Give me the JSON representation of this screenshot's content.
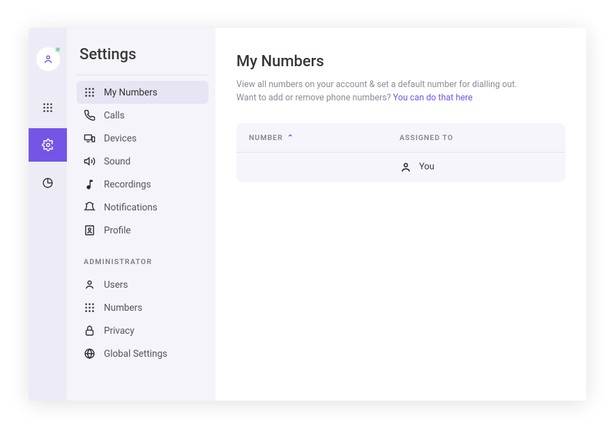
{
  "sidebar": {
    "title": "Settings",
    "items": [
      {
        "label": "My Numbers"
      },
      {
        "label": "Calls"
      },
      {
        "label": "Devices"
      },
      {
        "label": "Sound"
      },
      {
        "label": "Recordings"
      },
      {
        "label": "Notifications"
      },
      {
        "label": "Profile"
      }
    ],
    "adminLabel": "ADMINISTRATOR",
    "adminItems": [
      {
        "label": "Users"
      },
      {
        "label": "Numbers"
      },
      {
        "label": "Privacy"
      },
      {
        "label": "Global Settings"
      }
    ]
  },
  "main": {
    "title": "My Numbers",
    "descLine1": "View all numbers on your account & set a default number for dialling out.",
    "descLine2Prefix": "Want to add or remove phone numbers? ",
    "descLink": "You can do that here",
    "table": {
      "colNumber": "NUMBER",
      "colAssigned": "ASSIGNED TO",
      "rows": [
        {
          "number": "",
          "assignedTo": "You"
        }
      ]
    }
  }
}
